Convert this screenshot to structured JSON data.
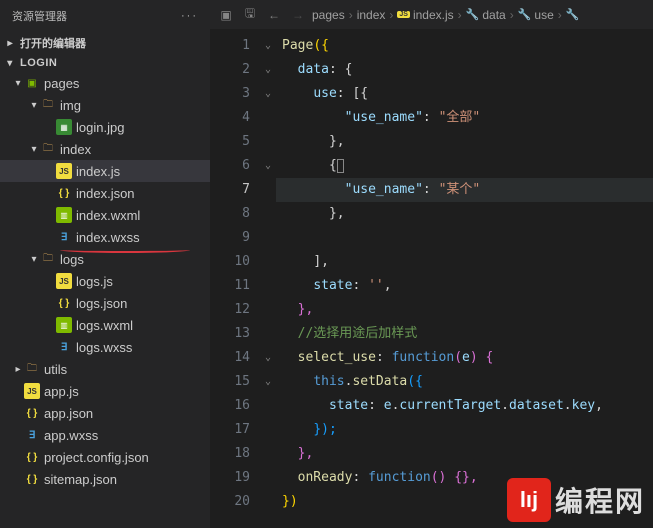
{
  "sidebar": {
    "title": "资源管理器",
    "sections": {
      "openEditors": "打开的编辑器",
      "project": "LOGIN"
    },
    "pages": "pages",
    "img": "img",
    "loginjpg": "login.jpg",
    "index": "index",
    "indexjs": "index.js",
    "indexjson": "index.json",
    "indexwxml": "index.wxml",
    "indexwxss": "index.wxss",
    "logs": "logs",
    "logsjs": "logs.js",
    "logsjson": "logs.json",
    "logswxml": "logs.wxml",
    "logswxss": "logs.wxss",
    "utils": "utils",
    "appjs": "app.js",
    "appjson": "app.json",
    "appwxss": "app.wxss",
    "projectconfig": "project.config.json",
    "sitemap": "sitemap.json"
  },
  "breadcrumb": {
    "items": [
      "pages",
      "index",
      "index.js",
      "data",
      "use"
    ]
  },
  "code": {
    "l1a": "Page",
    "l1b": "({",
    "l2a": "data",
    "l2b": ": {",
    "l3a": "use",
    "l3b": ": [{",
    "l4a": "\"use_name\"",
    "l4b": ": ",
    "l4c": "\"全部\"",
    "l5a": "},",
    "l6a": "{",
    "l7a": "\"use_name\"",
    "l7b": ": ",
    "l7c": "\"某个\"",
    "l8a": "},",
    "l10a": "],",
    "l11a": "state",
    "l11b": ": ",
    "l11c": "''",
    "l11d": ",",
    "l12a": "},",
    "l13a": "//选择用途后加样式",
    "l14a": "select_use",
    "l14b": ": ",
    "l14c": "function",
    "l14d": "(",
    "l14e": "e",
    "l14f": ") {",
    "l15a": "this",
    "l15b": ".",
    "l15c": "setData",
    "l15d": "({",
    "l16a": "state",
    "l16b": ": ",
    "l16c": "e",
    "l16d": ".",
    "l16e": "currentTarget",
    "l16f": ".",
    "l16g": "dataset",
    "l16h": ".",
    "l16i": "key",
    "l16j": ",",
    "l17a": "});",
    "l18a": "},",
    "l19a": "onReady",
    "l19b": ": ",
    "l19c": "function",
    "l19d": "() {},",
    "l20a": "})"
  },
  "watermark": {
    "logo": "lıj",
    "text": "编程网"
  }
}
